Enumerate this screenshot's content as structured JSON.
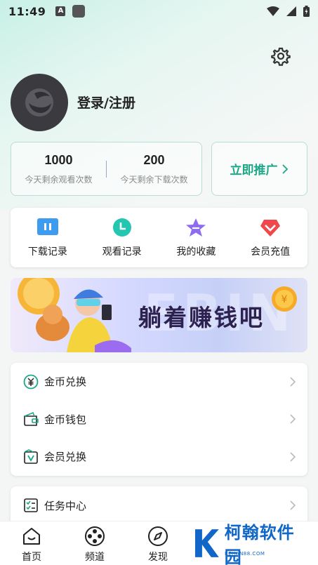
{
  "status_bar": {
    "time": "11:49",
    "notif_icon": "A"
  },
  "profile": {
    "login_label": "登录/注册"
  },
  "stats": [
    {
      "value": "1000",
      "label": "今天剩余观看次数"
    },
    {
      "value": "200",
      "label": "今天剩余下载次数"
    }
  ],
  "promote": {
    "label": "立即推广"
  },
  "quick_actions": [
    {
      "label": "下载记录",
      "icon": "download-record-icon",
      "color": "#3d9bf0"
    },
    {
      "label": "观看记录",
      "icon": "clock-icon",
      "color": "#23c6b0"
    },
    {
      "label": "我的收藏",
      "icon": "star-icon",
      "color": "#8e6cf0"
    },
    {
      "label": "会员充值",
      "icon": "vip-icon",
      "color": "#f0474c"
    }
  ],
  "banner": {
    "title": "躺着赚钱吧",
    "watermark": "EBIN"
  },
  "menu": [
    {
      "label": "金币兑换",
      "icon": "coin-exchange-icon"
    },
    {
      "label": "金币钱包",
      "icon": "wallet-icon"
    },
    {
      "label": "会员兑换",
      "icon": "vip-exchange-icon"
    }
  ],
  "task": {
    "label": "任务中心",
    "icon": "task-list-icon"
  },
  "bottom_nav": [
    {
      "label": "首页",
      "icon": "home-icon"
    },
    {
      "label": "频道",
      "icon": "film-reel-icon"
    },
    {
      "label": "发现",
      "icon": "compass-icon"
    }
  ],
  "watermark_logo": {
    "text": "柯翰软件园",
    "url_text": "KEHAN88.COM"
  },
  "colors": {
    "accent": "#1aa886",
    "brand_border": "#b9ddd2"
  }
}
